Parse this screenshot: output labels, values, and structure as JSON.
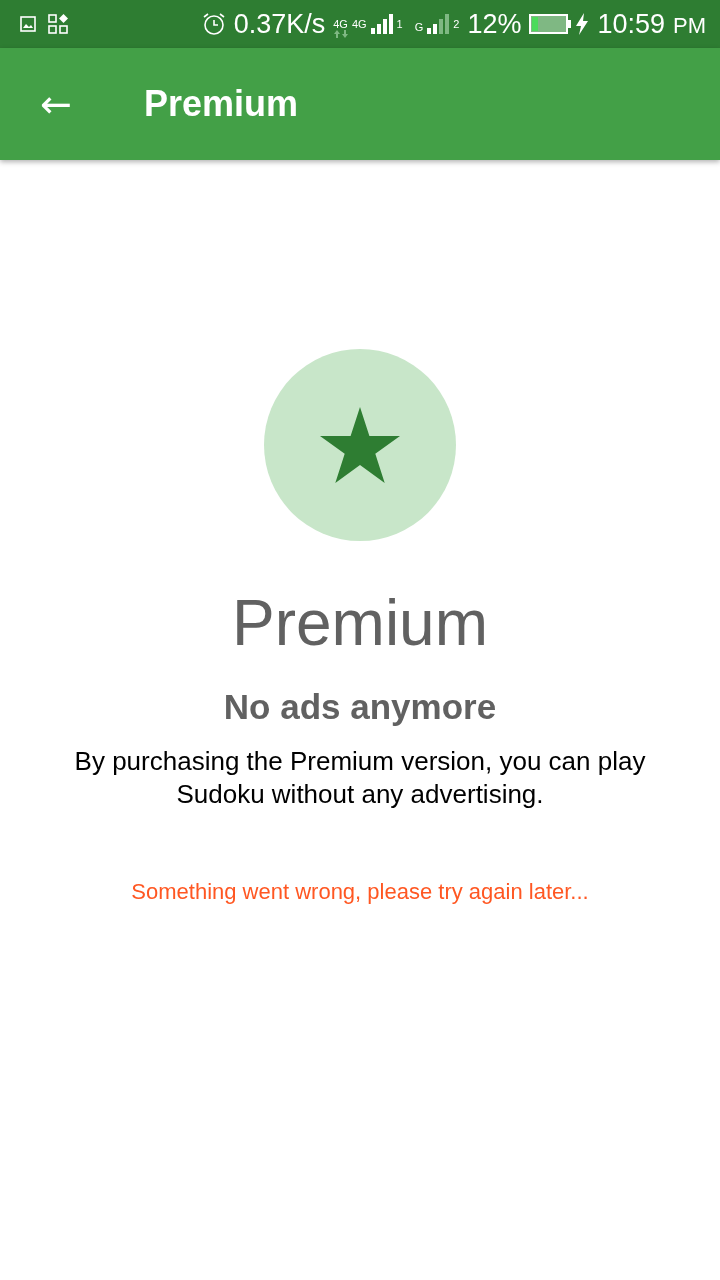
{
  "status_bar": {
    "speed": "0.37K/s",
    "sim1_network": "4G",
    "sim1_network_2": "4G",
    "sim1_slot": "1",
    "sim2_network": "G",
    "sim2_slot": "2",
    "battery": "12%",
    "time": "10:59",
    "meridiem": "PM"
  },
  "app_bar": {
    "back_icon": "←",
    "title": "Premium"
  },
  "content": {
    "heading": "Premium",
    "subheading": "No ads anymore",
    "description": "By purchasing the Premium version, you can play Sudoku without any advertising.",
    "error": "Something went wrong, please try again later..."
  }
}
